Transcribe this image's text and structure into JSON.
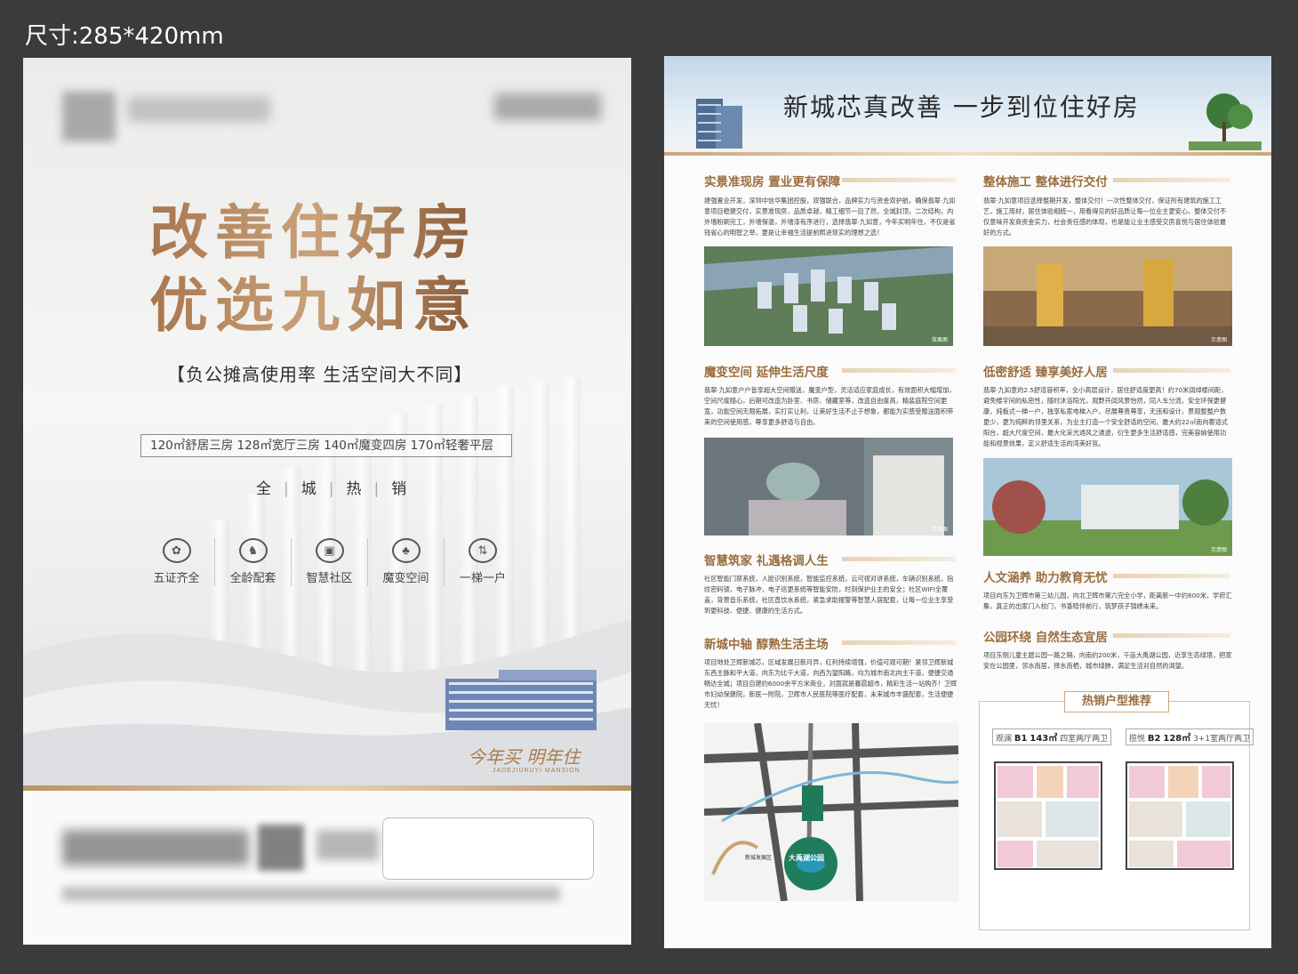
{
  "size_label": "尺寸:285*420mm",
  "front": {
    "headline_line1": "改善住好房",
    "headline_line2": "优选九如意",
    "subhead": "【负公摊高使用率 生活空间大不同】",
    "unit_types": "120㎡舒居三房 128㎡宽厅三房 140㎡魔变四房 170㎡轻奢平层",
    "hot_sale": [
      "全",
      "城",
      "热",
      "销"
    ],
    "features": [
      {
        "label": "五证齐全",
        "icon": "certificate-icon"
      },
      {
        "label": "全龄配套",
        "icon": "rocking-horse-icon"
      },
      {
        "label": "智慧社区",
        "icon": "smart-lock-icon"
      },
      {
        "label": "魔变空间",
        "icon": "clover-icon"
      },
      {
        "label": "一梯一户",
        "icon": "elevator-icon"
      }
    ],
    "slogan": "今年买 明年住",
    "slogan_en": "JADEJIURUYI MANSION"
  },
  "back": {
    "banner_title": "新城芯真改善 一步到位住好房",
    "sections": [
      {
        "title": "实景准现房 置业更有保障",
        "body": "建强置业开发，深圳中信华集团控股，双强联合，品牌实力与资金双护航，确保翡翠·九如意项目稳健交付，实景准现房，品质卓越，精工细节一目了然，全城封顶，二次结构，内外墙粉刷完工，外墙保温，外墙漆有序进行，选择翡翠·九如意，今年买明年住，不仅是省钱省心的明智之举，更是让幸福生活提前照进现实的理想之选！",
        "photo_tag": "效果图"
      },
      {
        "title": "整体施工 整体进行交付",
        "body": "翡翠·九如意项目选择整期开发，整体交付！一次性整体交付，保证所有建筑的施工工艺，施工用材，居住体验相统一，用看得见的好品质让每一位业主更安心，整体交付不仅意味开发商资金实力，社会责任感的体现，也是能让业主感受交房喜悦与居住体验最好的方式。",
        "photo_tag": "示意图"
      },
      {
        "title": "魔变空间 延伸生活尺度",
        "body": "翡翠·九如意户户皆享超大空间赠送，魔变户型，灵活适应家庭成长，有效面积大幅增加，空间尺度随心，后期可改造为卧室、书房、储藏室等，改造自由度高，精装庭院空间更宽，功能空间无限拓展，实打实让利，让美好生活不止于想象，都能为实感受赠送面积带来的空间使用感，尊享更多舒适与自由。",
        "photo_tag": "示意图"
      },
      {
        "title": "低密舒适 臻享美好人居",
        "body": "翡翠·九如意的2.5舒适容积率，全小高层设计，居住舒适度更高！约70米阔绰楼间距，避免楼宇间的私密性，随时沐浴阳光，观野开阔风景怡然，同人车分流，安全环保更健康，纯板式一梯一户，独享私家电梯入户，尽展尊贵尊享，无违和设计，景观整整户数更少，更为纯粹的邻里关系，为业主打造一个安全舒适的空间，最大约22㎡南向奢适式阳台，超大尺度空间，最大化采光通风之通透，衍生更多生活舒适感，完美容纳使用功能和视景效果，定义舒适生活的湾美好氛。",
        "photo_tag": "示意图"
      },
      {
        "title": "智慧筑家 礼遇格调人生",
        "body": "社区智能门禁系统，人脸识别系统，智能监控系统，云可视对讲系统，车辆识别系统，指纹密码锁，电子脉冲，电子巡更系统等智能安防，时刻保护业主的安全；社区WIFI全覆盖，背景音乐系统，社区直饮水系统，紧急求助报警等智慧人居配套，让每一位业主享受到更科技、便捷、健康的生活方式。",
        "photo_tag": ""
      },
      {
        "title": "人文涵养 助力教育无忧",
        "body": "项目向东为卫辉市第三幼儿园，向北卫辉市第六完全小学，距离新一中约800米，学府汇集，真正的出家门入校门，书香陪伴前行，筑梦孩子锦绣未来。",
        "photo_tag": ""
      },
      {
        "title": "新城中轴 醇熟生活主场",
        "body": "项目地处卫辉新城芯，区域发展日新月异，红利持续增强，价值可观可期！紧邻卫辉新城东西主脉和平大道，向东为比干大道，向西为望阳路，均为城市南北向主干道，便捷交通畅达全城；项目自建约6000余平方米商业，对面就是暮晨超市，精彩生活一站购齐！卫辉市妇幼保健院，新医一附院，卫辉市人民医院等医疗配套，未来城市丰盛配套，生活便捷无忧！",
        "photo_tag": ""
      },
      {
        "title": "公园环绕 自然生态宜居",
        "body": "项目东侧儿童主题公园一路之隔，向南约200米，千亩大禹湖公园，近享生态绿境，把家安在公园里，邻水而居，择水而栖，城市绿肺，满足生活对自然的渴望。",
        "photo_tag": ""
      }
    ],
    "plans_title": "热销户型推荐",
    "plan_a": {
      "name": "观澜",
      "code": "B1",
      "area": "143㎡",
      "layout": "四室两厅两卫"
    },
    "plan_b": {
      "name": "揽悦",
      "code": "B2",
      "area": "128㎡",
      "layout": "3+1室两厅两卫"
    },
    "map_labels": [
      "大禹湖公园",
      "新城发展区"
    ]
  }
}
